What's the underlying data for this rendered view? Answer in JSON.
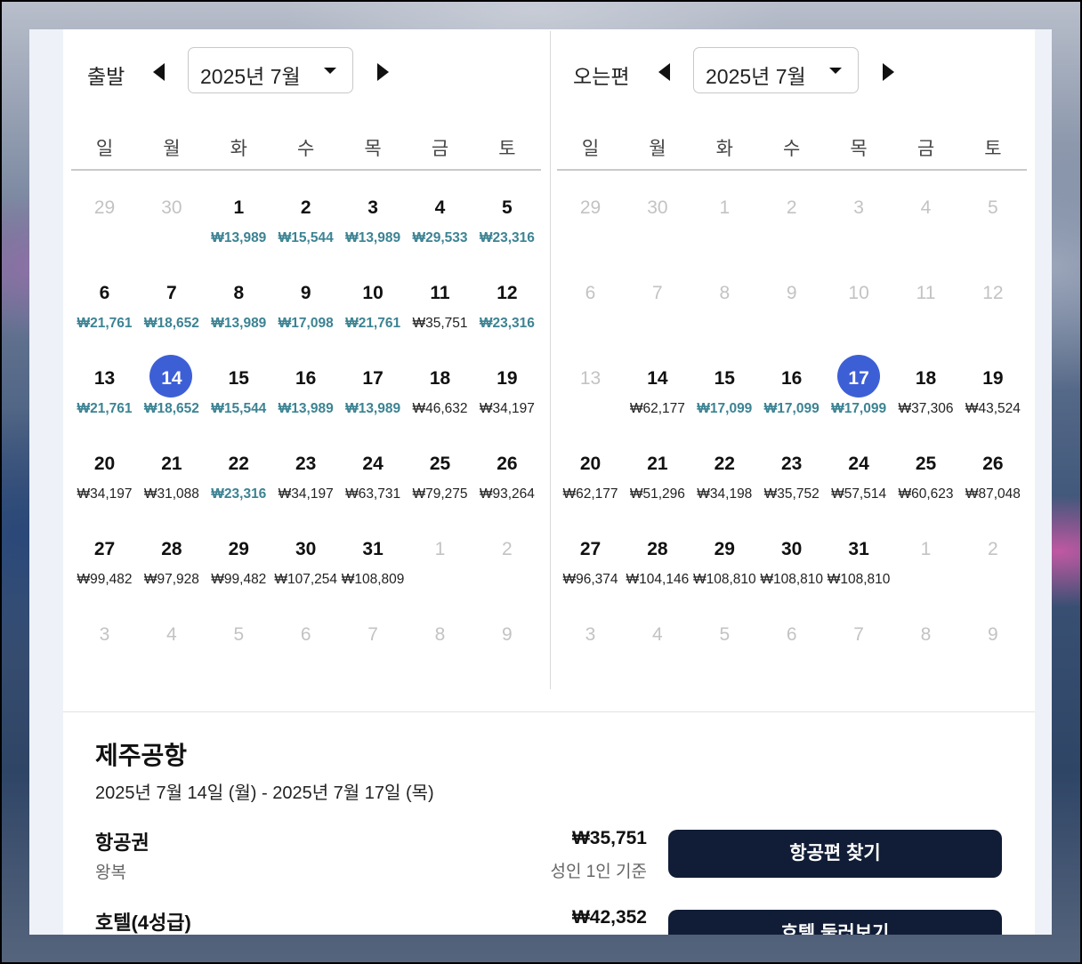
{
  "departure": {
    "label": "출발",
    "month_label": "2025년 7월",
    "weekdays": [
      "일",
      "월",
      "화",
      "수",
      "목",
      "금",
      "토"
    ],
    "weeks": [
      [
        {
          "d": "29",
          "m": true
        },
        {
          "d": "30",
          "m": true
        },
        {
          "d": "1",
          "p": "₩13,989",
          "low": true
        },
        {
          "d": "2",
          "p": "₩15,544",
          "low": true
        },
        {
          "d": "3",
          "p": "₩13,989",
          "low": true
        },
        {
          "d": "4",
          "p": "₩29,533",
          "low": true
        },
        {
          "d": "5",
          "p": "₩23,316",
          "low": true
        }
      ],
      [
        {
          "d": "6",
          "p": "₩21,761",
          "low": true
        },
        {
          "d": "7",
          "p": "₩18,652",
          "low": true
        },
        {
          "d": "8",
          "p": "₩13,989",
          "low": true
        },
        {
          "d": "9",
          "p": "₩17,098",
          "low": true
        },
        {
          "d": "10",
          "p": "₩21,761",
          "low": true
        },
        {
          "d": "11",
          "p": "₩35,751"
        },
        {
          "d": "12",
          "p": "₩23,316",
          "low": true
        }
      ],
      [
        {
          "d": "13",
          "p": "₩21,761",
          "low": true
        },
        {
          "d": "14",
          "p": "₩18,652",
          "low": true,
          "sel": true
        },
        {
          "d": "15",
          "p": "₩15,544",
          "low": true
        },
        {
          "d": "16",
          "p": "₩13,989",
          "low": true
        },
        {
          "d": "17",
          "p": "₩13,989",
          "low": true
        },
        {
          "d": "18",
          "p": "₩46,632"
        },
        {
          "d": "19",
          "p": "₩34,197"
        }
      ],
      [
        {
          "d": "20",
          "p": "₩34,197"
        },
        {
          "d": "21",
          "p": "₩31,088"
        },
        {
          "d": "22",
          "p": "₩23,316",
          "low": true
        },
        {
          "d": "23",
          "p": "₩34,197"
        },
        {
          "d": "24",
          "p": "₩63,731"
        },
        {
          "d": "25",
          "p": "₩79,275"
        },
        {
          "d": "26",
          "p": "₩93,264"
        }
      ],
      [
        {
          "d": "27",
          "p": "₩99,482"
        },
        {
          "d": "28",
          "p": "₩97,928"
        },
        {
          "d": "29",
          "p": "₩99,482"
        },
        {
          "d": "30",
          "p": "₩107,254"
        },
        {
          "d": "31",
          "p": "₩108,809"
        },
        {
          "d": "1",
          "m": true
        },
        {
          "d": "2",
          "m": true
        }
      ],
      [
        {
          "d": "3",
          "m": true
        },
        {
          "d": "4",
          "m": true
        },
        {
          "d": "5",
          "m": true
        },
        {
          "d": "6",
          "m": true
        },
        {
          "d": "7",
          "m": true
        },
        {
          "d": "8",
          "m": true
        },
        {
          "d": "9",
          "m": true
        }
      ]
    ]
  },
  "return": {
    "label": "오는편",
    "month_label": "2025년 7월",
    "weekdays": [
      "일",
      "월",
      "화",
      "수",
      "목",
      "금",
      "토"
    ],
    "weeks": [
      [
        {
          "d": "29",
          "m": true
        },
        {
          "d": "30",
          "m": true
        },
        {
          "d": "1",
          "m": true
        },
        {
          "d": "2",
          "m": true
        },
        {
          "d": "3",
          "m": true
        },
        {
          "d": "4",
          "m": true
        },
        {
          "d": "5",
          "m": true
        }
      ],
      [
        {
          "d": "6",
          "m": true
        },
        {
          "d": "7",
          "m": true
        },
        {
          "d": "8",
          "m": true
        },
        {
          "d": "9",
          "m": true
        },
        {
          "d": "10",
          "m": true
        },
        {
          "d": "11",
          "m": true
        },
        {
          "d": "12",
          "m": true
        }
      ],
      [
        {
          "d": "13",
          "m": true
        },
        {
          "d": "14",
          "p": "₩62,177"
        },
        {
          "d": "15",
          "p": "₩17,099",
          "low": true
        },
        {
          "d": "16",
          "p": "₩17,099",
          "low": true
        },
        {
          "d": "17",
          "p": "₩17,099",
          "low": true,
          "sel": true
        },
        {
          "d": "18",
          "p": "₩37,306"
        },
        {
          "d": "19",
          "p": "₩43,524"
        }
      ],
      [
        {
          "d": "20",
          "p": "₩62,177"
        },
        {
          "d": "21",
          "p": "₩51,296"
        },
        {
          "d": "22",
          "p": "₩34,198"
        },
        {
          "d": "23",
          "p": "₩35,752"
        },
        {
          "d": "24",
          "p": "₩57,514"
        },
        {
          "d": "25",
          "p": "₩60,623"
        },
        {
          "d": "26",
          "p": "₩87,048"
        }
      ],
      [
        {
          "d": "27",
          "p": "₩96,374"
        },
        {
          "d": "28",
          "p": "₩104,146"
        },
        {
          "d": "29",
          "p": "₩108,810"
        },
        {
          "d": "30",
          "p": "₩108,810"
        },
        {
          "d": "31",
          "p": "₩108,810"
        },
        {
          "d": "1",
          "m": true
        },
        {
          "d": "2",
          "m": true
        }
      ],
      [
        {
          "d": "3",
          "m": true
        },
        {
          "d": "4",
          "m": true
        },
        {
          "d": "5",
          "m": true
        },
        {
          "d": "6",
          "m": true
        },
        {
          "d": "7",
          "m": true
        },
        {
          "d": "8",
          "m": true
        },
        {
          "d": "9",
          "m": true
        }
      ]
    ]
  },
  "summary": {
    "title": "제주공항",
    "dates": "2025년 7월 14일 (월) - 2025년 7월 17일 (목)",
    "flight": {
      "title": "항공권",
      "sub": "왕복",
      "price": "₩35,751",
      "note": "성인 1인 기준",
      "button": "항공편 찾기"
    },
    "hotel": {
      "title": "호텔(4성급)",
      "price": "₩42,352",
      "button": "호텔 둘러보기"
    }
  },
  "colors": {
    "selected": "#3d5fd6",
    "low_price": "#3c8393",
    "button_bg": "#111d36"
  },
  "icons": [
    "prev-month-icon",
    "next-month-icon",
    "dropdown-caret-icon"
  ]
}
